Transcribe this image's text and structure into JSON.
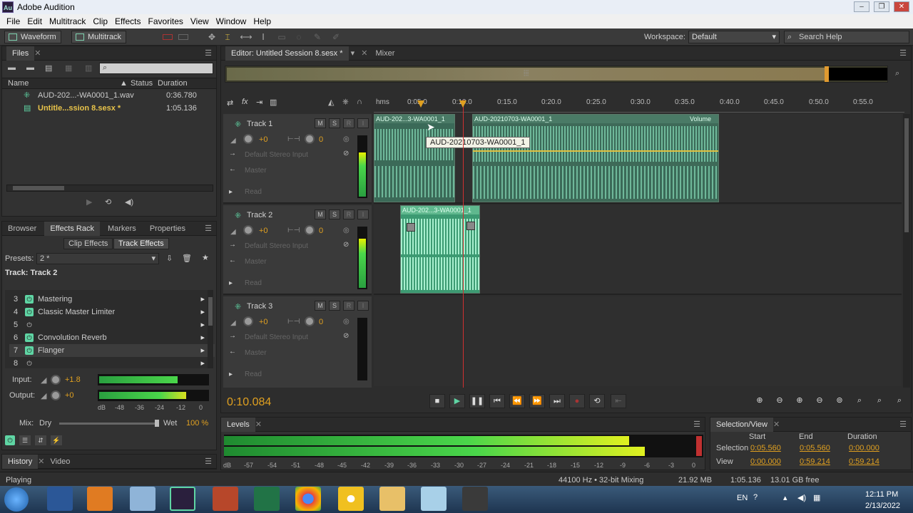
{
  "window": {
    "title": "Adobe Audition",
    "app_icon": "Au"
  },
  "menu": [
    "File",
    "Edit",
    "Multitrack",
    "Clip",
    "Effects",
    "Favorites",
    "View",
    "Window",
    "Help"
  ],
  "toolbar": {
    "waveform": "Waveform",
    "multitrack": "Multitrack",
    "workspace_label": "Workspace:",
    "workspace_value": "Default",
    "search_placeholder": "Search Help"
  },
  "files": {
    "tab": "Files",
    "columns": [
      "Name",
      "Status",
      "Duration"
    ],
    "rows": [
      {
        "name": "AUD-202...-WA0001_1.wav",
        "status": "",
        "duration": "0:36.780"
      },
      {
        "name": "Untitle...ssion 8.sesx *",
        "status": "",
        "duration": "1:05.136"
      }
    ]
  },
  "effects": {
    "tabs": [
      "Browser",
      "Effects Rack",
      "Markers",
      "Properties"
    ],
    "subtabs": [
      "Clip Effects",
      "Track Effects"
    ],
    "presets_label": "Presets:",
    "presets_value": "2 *",
    "track_label": "Track: Track 2",
    "rows": [
      {
        "n": "3",
        "name": "Mastering"
      },
      {
        "n": "4",
        "name": "Classic Master Limiter"
      },
      {
        "n": "5",
        "name": ""
      },
      {
        "n": "6",
        "name": "Convolution Reverb"
      },
      {
        "n": "7",
        "name": "Flanger"
      },
      {
        "n": "8",
        "name": ""
      }
    ],
    "input_label": "Input:",
    "input_value": "+1.8",
    "output_label": "Output:",
    "output_value": "+0",
    "mix_label": "Mix:",
    "dry": "Dry",
    "wet": "Wet",
    "wet_value": "100 %",
    "scale": [
      "dB",
      "-48",
      "-36",
      "-24",
      "-12",
      "0"
    ]
  },
  "history": {
    "tabs": [
      "History",
      "Video"
    ]
  },
  "status": {
    "left": "Playing",
    "rate": "44100 Hz • 32-bit Mixing",
    "size": "21.92 MB",
    "duration": "1:05.136",
    "free": "13.01 GB free"
  },
  "editor": {
    "tab": "Editor: Untitled Session 8.sesx *",
    "mixer": "Mixer",
    "time": "0:10.084",
    "ruler": [
      "hms",
      "0:05.0",
      "0:10.0",
      "0:15.0",
      "0:20.0",
      "0:25.0",
      "0:30.0",
      "0:35.0",
      "0:40.0",
      "0:45.0",
      "0:50.0",
      "0:55.0"
    ],
    "tooltip": "AUD-20210703-WA0001_1",
    "clips": {
      "t1a": "AUD-202...3-WA0001_1",
      "t1b": "AUD-20210703-WA0001_1",
      "t1vol": "Volume",
      "t2": "AUD-202...3-WA0001_1"
    },
    "tracks": [
      {
        "name": "Track 1",
        "vol": "+0",
        "pan": "0",
        "input": "Default Stereo Input",
        "output": "Master",
        "read": "Read"
      },
      {
        "name": "Track 2",
        "vol": "+0",
        "pan": "0",
        "input": "Default Stereo Input",
        "output": "Master",
        "read": "Read"
      },
      {
        "name": "Track 3",
        "vol": "+0",
        "pan": "0",
        "input": "Default Stereo Input",
        "output": "Master",
        "read": "Read"
      }
    ]
  },
  "levels": {
    "tab": "Levels",
    "scale": [
      "dB",
      "-57",
      "-54",
      "-51",
      "-48",
      "-45",
      "-42",
      "-39",
      "-36",
      "-33",
      "-30",
      "-27",
      "-24",
      "-21",
      "-18",
      "-15",
      "-12",
      "-9",
      "-6",
      "-3",
      "0"
    ]
  },
  "selection": {
    "tab": "Selection/View",
    "cols": [
      "Start",
      "End",
      "Duration"
    ],
    "sel_label": "Selection",
    "sel": [
      "0:05.560",
      "0:05.560",
      "0:00.000"
    ],
    "view_label": "View",
    "view": [
      "0:00.000",
      "0:59.214",
      "0:59.214"
    ]
  },
  "taskbar": {
    "lang": "EN",
    "time": "12:11 PM",
    "date": "2/13/2022"
  }
}
